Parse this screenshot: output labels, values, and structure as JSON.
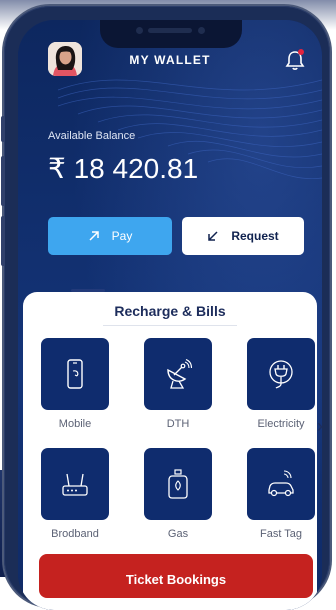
{
  "header": {
    "title": "MY WALLET",
    "avatar_icon": "user-avatar",
    "notification_icon": "bell-icon",
    "notification_badge_color": "#e2243f"
  },
  "balance": {
    "label": "Available Balance",
    "amount": "₹ 18 420.81"
  },
  "actions": {
    "pay_label": "Pay",
    "pay_icon": "arrow-up-right-icon",
    "request_label": "Request",
    "request_icon": "arrow-down-left-icon"
  },
  "recharge": {
    "title": "Recharge & Bills",
    "items": [
      {
        "label": "Mobile",
        "icon": "mobile-icon"
      },
      {
        "label": "DTH",
        "icon": "satellite-dish-icon"
      },
      {
        "label": "Electricity",
        "icon": "plug-icon"
      },
      {
        "label": "Brodband",
        "icon": "router-icon"
      },
      {
        "label": "Gas",
        "icon": "gas-cylinder-icon"
      },
      {
        "label": "Fast Tag",
        "icon": "car-tag-icon"
      }
    ],
    "more_icon": "chevron-right-icon"
  },
  "ticket": {
    "label": "Ticket Bookings"
  },
  "colors": {
    "primary_dark": "#0f2c6e",
    "accent_blue": "#3ea6ef",
    "ticket_red": "#c5221f"
  }
}
